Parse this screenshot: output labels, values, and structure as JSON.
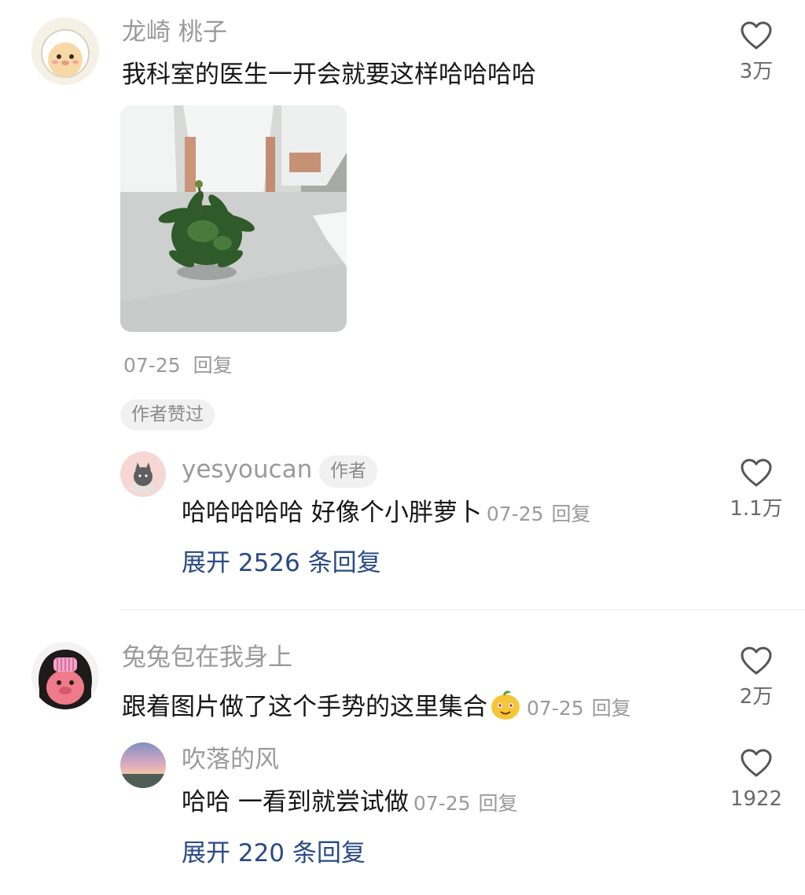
{
  "comments": [
    {
      "username": "龙崎 桃子",
      "text": "我科室的医生一开会就要这样哈哈哈哈",
      "date": "07-25",
      "reply_label": "回复",
      "likes": "3万",
      "badge": "作者赞过",
      "replies": [
        {
          "username": "yesyoucan",
          "tag": "作者",
          "text": "哈哈哈哈哈 好像个小胖萝卜",
          "date": "07-25",
          "reply_label": "回复",
          "likes": "1.1万"
        }
      ],
      "expand_label": "展开 2526 条回复"
    },
    {
      "username": "兔兔包在我身上",
      "text": "跟着图片做了这个手势的这里集合",
      "emoji": "smiling-mango-sticker",
      "date": "07-25",
      "reply_label": "回复",
      "likes": "2万",
      "replies": [
        {
          "username": "吹落的风",
          "text": "哈哈 一看到就尝试做",
          "date": "07-25",
          "reply_label": "回复",
          "likes": "1922"
        }
      ],
      "expand_label": "展开 220 条回复"
    }
  ],
  "colors": {
    "username": "#9a9a9a",
    "text": "#161616",
    "link": "#2a4a84",
    "chip_bg": "#f1f1f1"
  }
}
